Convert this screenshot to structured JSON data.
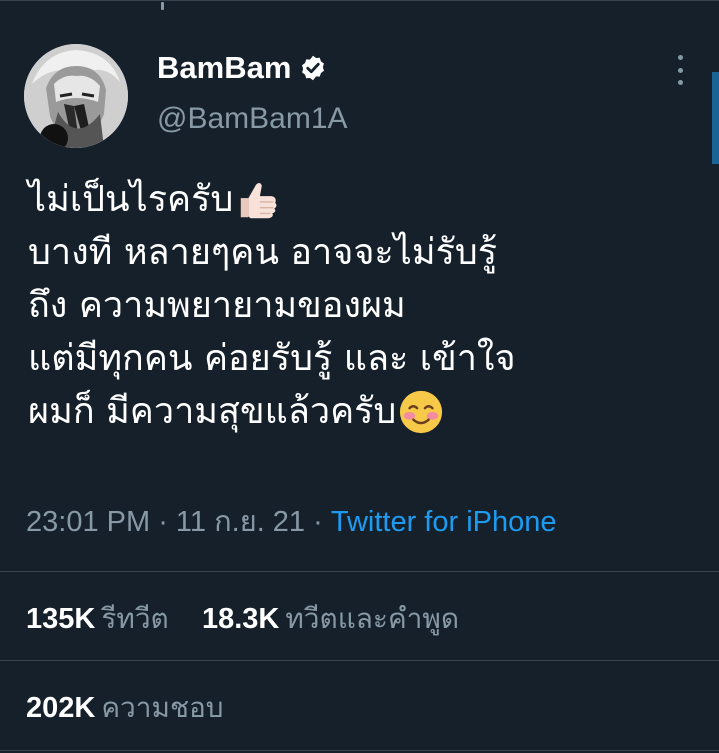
{
  "author": {
    "name": "BamBam",
    "handle": "@BamBam1A",
    "verified": true
  },
  "tweet": {
    "lines": [
      "ไม่เป็นไรครับ",
      "บางที หลายๆคน อาจจะไม่รับรู้",
      "ถึง ความพยายามของผม",
      "แต่มีทุกคน ค่อยรับรู้ และ เข้าใจ",
      "ผมก็ มีความสุขแล้วครับ"
    ],
    "emojis": [
      "thumbs-up-emoji",
      "smiling-blush-emoji"
    ]
  },
  "meta": {
    "time": "23:01 PM",
    "sep1": " · ",
    "date": "11 ก.ย. 21",
    "sep2": " · ",
    "source": "Twitter for iPhone"
  },
  "stats": {
    "retweets_count": "135K",
    "retweets_label": "รีทวีต",
    "quotes_count": "18.3K",
    "quotes_label": "ทวีตและคำพูด",
    "likes_count": "202K",
    "likes_label": "ความชอบ"
  },
  "colors": {
    "background": "#15202b",
    "text_primary": "#ffffff",
    "text_secondary": "#8899a6",
    "accent": "#1d9bf0",
    "divider": "#38444d"
  }
}
